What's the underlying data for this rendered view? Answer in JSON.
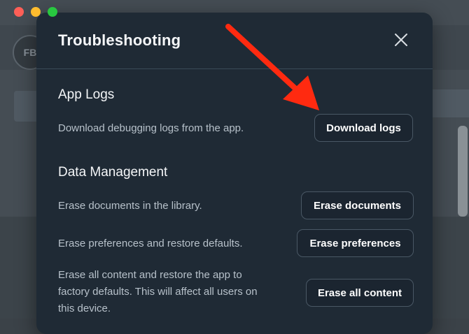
{
  "window": {
    "traffic_lights": [
      "close",
      "minimize",
      "zoom"
    ]
  },
  "background_app": {
    "avatar_text": "FB"
  },
  "modal": {
    "title": "Troubleshooting",
    "close_icon": "close-icon",
    "sections": {
      "app_logs": {
        "title": "App Logs",
        "rows": [
          {
            "description": "Download debugging logs from the app.",
            "button": "Download logs"
          }
        ]
      },
      "data_management": {
        "title": "Data Management",
        "rows": [
          {
            "description": "Erase documents in the library.",
            "button": "Erase documents"
          },
          {
            "description": "Erase preferences and restore defaults.",
            "button": "Erase preferences"
          },
          {
            "description_lines": [
              "Erase all content and restore the app to",
              "factory defaults. This will affect all users on",
              "this device."
            ],
            "button": "Erase all content"
          }
        ]
      }
    }
  },
  "annotation": {
    "arrow_color": "#ff2a10"
  },
  "colors": {
    "modal_bg": "#1f2a35",
    "button_border": "#4a5865",
    "text_secondary": "#b7c1ca"
  }
}
